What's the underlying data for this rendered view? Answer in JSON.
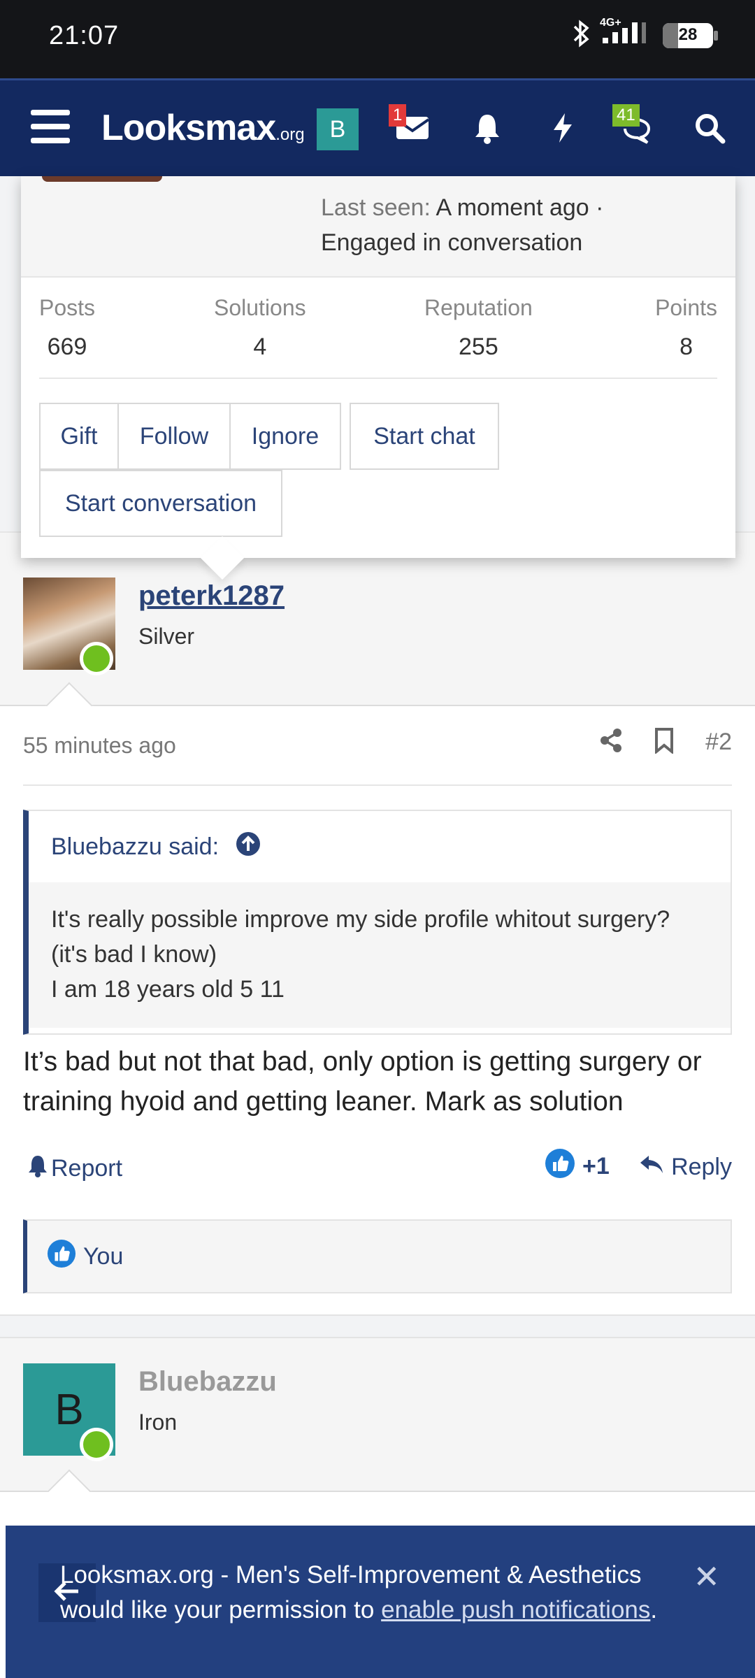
{
  "status_bar": {
    "time": "21:07",
    "network": "4G+",
    "battery": "28"
  },
  "header": {
    "logo_main": "Looksmax",
    "logo_suffix": ".org",
    "avatar_letter": "B",
    "inbox_badge": "1",
    "alerts_badge": "41"
  },
  "popup": {
    "last_seen_label": "Last seen:",
    "last_seen_value": "A moment ago ·",
    "activity": "Engaged in conversation",
    "stats": [
      {
        "label": "Posts",
        "value": "669"
      },
      {
        "label": "Solutions",
        "value": "4"
      },
      {
        "label": "Reputation",
        "value": "255"
      },
      {
        "label": "Points",
        "value": "8"
      }
    ],
    "buttons": {
      "gift": "Gift",
      "follow": "Follow",
      "ignore": "Ignore",
      "start_chat": "Start chat",
      "start_conversation": "Start conversation"
    }
  },
  "post": {
    "author": "peterk1287",
    "rank": "Silver",
    "time": "55 minutes ago",
    "number": "#2",
    "quote_author": "Bluebazzu said:",
    "quote_lines": [
      "It's really possible improve my side profile whitout surgery?",
      "(it's bad I know)",
      "I am 18 years old 5 11"
    ],
    "body": "It’s bad but not that bad, only option is getting surgery or training hyoid and getting leaner. Mark as solution",
    "report_label": "Report",
    "reaction_count": "+1",
    "reply_label": "Reply",
    "liked_by": "You"
  },
  "next_post": {
    "avatar_letter": "B",
    "author": "Bluebazzu",
    "rank": "Iron"
  },
  "push_banner": {
    "text": "Looksmax.org - Men's Self-Improvement & Aesthetics would like your permission to",
    "link": "enable push notifications",
    "end": "."
  },
  "colors": {
    "header_bg": "#132960",
    "accent": "#2b4478",
    "online": "#6fbf1f",
    "avatar_teal": "#2b9a96"
  }
}
